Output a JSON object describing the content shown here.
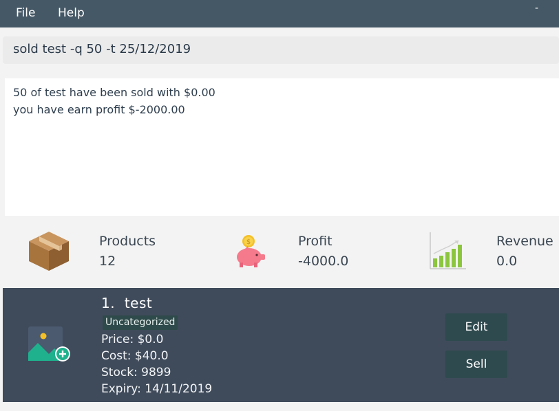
{
  "menubar": {
    "file": "File",
    "help": "Help",
    "minimize": "-"
  },
  "command": {
    "value": "sold test -q 50 -t 25/12/2019"
  },
  "result": {
    "line1": "50 of test have been sold with $0.00",
    "line2": "you have earn profit $-2000.00"
  },
  "stats": {
    "products": {
      "label": "Products",
      "value": "12",
      "icon": "box-icon"
    },
    "profit": {
      "label": "Profit",
      "value": "-4000.0",
      "icon": "piggy-bank-icon"
    },
    "revenue": {
      "label": "Revenue",
      "value": "0.0",
      "icon": "bar-chart-icon"
    }
  },
  "product": {
    "index": "1.",
    "name": "test",
    "category": "Uncategorized",
    "price": "Price: $0.0",
    "cost": "Cost: $40.0",
    "stock": "Stock: 9899",
    "expiry": "Expiry: 14/11/2019",
    "edit_label": "Edit",
    "sell_label": "Sell",
    "image_icon": "add-image-icon"
  },
  "colors": {
    "menubar": "#455866",
    "card": "#3f4b5b",
    "button": "#2f4a4f",
    "accent_green": "#1fb18e"
  }
}
